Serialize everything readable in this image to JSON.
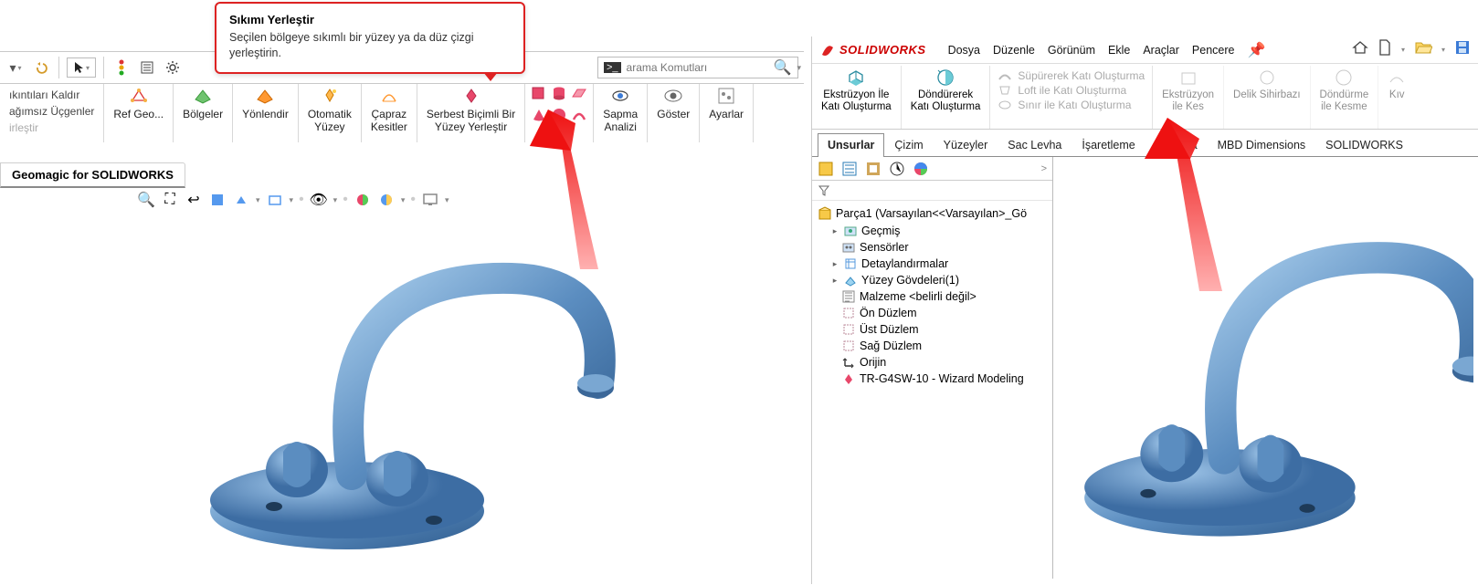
{
  "tooltip": {
    "title": "Sıkımı Yerleştir",
    "desc": "Seçilen bölgeye sıkımlı bir yüzey ya da düz çizgi yerleştirin."
  },
  "search": {
    "placeholder": "arama Komutları"
  },
  "left_ribbon_textcol": {
    "l1": "ıkıntıları Kaldır",
    "l2": "ağımsız Üçgenler",
    "l3": "irleştir"
  },
  "left_ribbon": {
    "refgeo": "Ref Geo...",
    "bolgeler": "Bölgeler",
    "yonlendir": "Yönlendir",
    "oto1": "Otomatik",
    "oto2": "Yüzey",
    "cap1": "Çapraz",
    "cap2": "Kesitler",
    "ser1": "Serbest Biçimli Bir",
    "ser2": "Yüzey Yerleştir",
    "sap1": "Sapma",
    "sap2": "Analizi",
    "goster": "Göster",
    "ayarlar": "Ayarlar"
  },
  "left_tab": "Geomagic for SOLIDWORKS",
  "sw": {
    "brand": "SOLIDWORKS",
    "menu": [
      "Dosya",
      "Düzenle",
      "Görünüm",
      "Ekle",
      "Araçlar",
      "Pencere"
    ],
    "rib": {
      "eks1": "Ekstrüzyon İle",
      "eks2": "Katı Oluşturma",
      "don1": "Döndürerek",
      "don2": "Katı Oluşturma",
      "list": [
        "Süpürerek Katı Oluşturma",
        "Loft ile Katı Oluşturma",
        "Sınır ile Katı Oluşturma"
      ],
      "ekskes1": "Ekstrüzyon",
      "ekskes2": "ile Kes",
      "delik": "Delik Sihirbazı",
      "donkes1": "Döndürme",
      "donkes2": "ile Kesme",
      "extra": "Kıv"
    },
    "tabs": [
      "Unsurlar",
      "Çizim",
      "Yüzeyler",
      "Sac Levha",
      "İşaretleme",
      "Hesapla",
      "MBD Dimensions",
      "SOLIDWORKS"
    ],
    "tree": {
      "root": "Parça1  (Varsayılan<<Varsayılan>_Gö",
      "items": [
        "Geçmiş",
        "Sensörler",
        "Detaylandırmalar",
        "Yüzey Gövdeleri(1)",
        "Malzeme <belirli değil>",
        "Ön Düzlem",
        "Üst Düzlem",
        "Sağ Düzlem",
        "Orijin",
        "TR-G4SW-10 - Wizard Modeling"
      ]
    }
  }
}
